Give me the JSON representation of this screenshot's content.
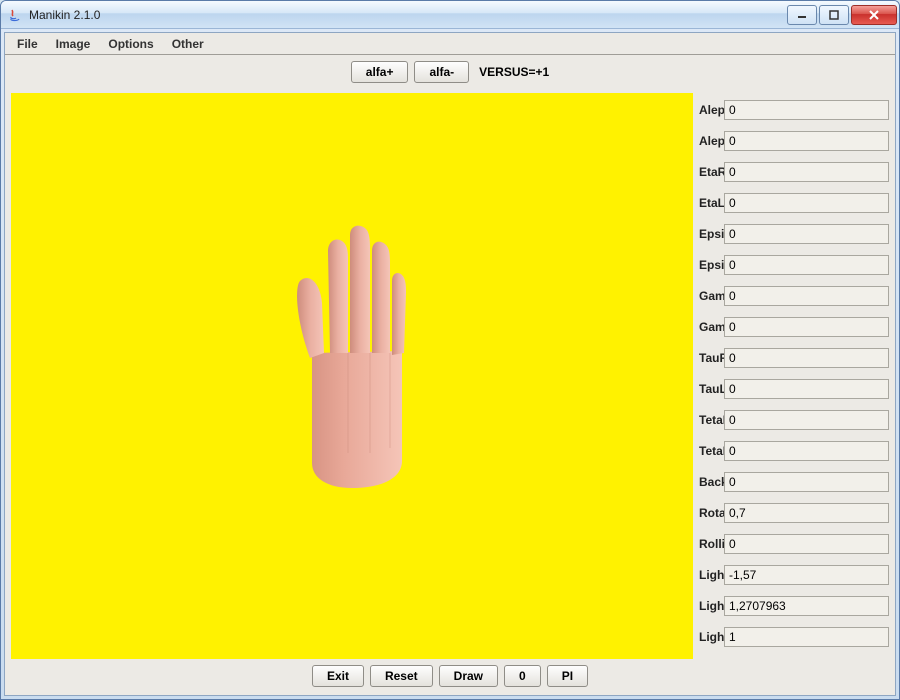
{
  "window": {
    "title": "Manikin 2.1.0"
  },
  "menu": {
    "file": "File",
    "image": "Image",
    "options": "Options",
    "other": "Other"
  },
  "toolbar": {
    "alfa_plus": "alfa+",
    "alfa_minus": "alfa-",
    "versus": "VERSUS=+1"
  },
  "params": [
    {
      "label": "AlephRight:",
      "value": "0"
    },
    {
      "label": "AlephLeft:",
      "value": "0"
    },
    {
      "label": "EtaRight:",
      "value": "0"
    },
    {
      "label": "EtaLeft:",
      "value": "0"
    },
    {
      "label": "EpsilonRight:",
      "value": "0"
    },
    {
      "label": "EpsilonLeft:",
      "value": "0"
    },
    {
      "label": "GammaRight:",
      "value": "0"
    },
    {
      "label": "GammaLeft:",
      "value": "0"
    },
    {
      "label": "TauRight:",
      "value": "0"
    },
    {
      "label": "TauLeft:",
      "value": "0"
    },
    {
      "label": "TetaRight:",
      "value": "0"
    },
    {
      "label": "TetaLeft:",
      "value": "0"
    },
    {
      "label": "BackAngle:",
      "value": "0"
    },
    {
      "label": "RotationAngle:",
      "value": "0,7"
    },
    {
      "label": "Rolling:",
      "value": "0"
    },
    {
      "label": "Light angle fi:",
      "value": "-1,57"
    },
    {
      "label": "Light angle teta:",
      "value": "1,2707963"
    },
    {
      "label": "Light intensity:",
      "value": "1"
    }
  ],
  "footer": {
    "exit": "Exit",
    "reset": "Reset",
    "draw": "Draw",
    "zero": "0",
    "pi": "PI"
  },
  "colors": {
    "canvas_bg": "#fff200",
    "hand_light": "#f0b8ab",
    "hand_dark": "#d89484"
  }
}
